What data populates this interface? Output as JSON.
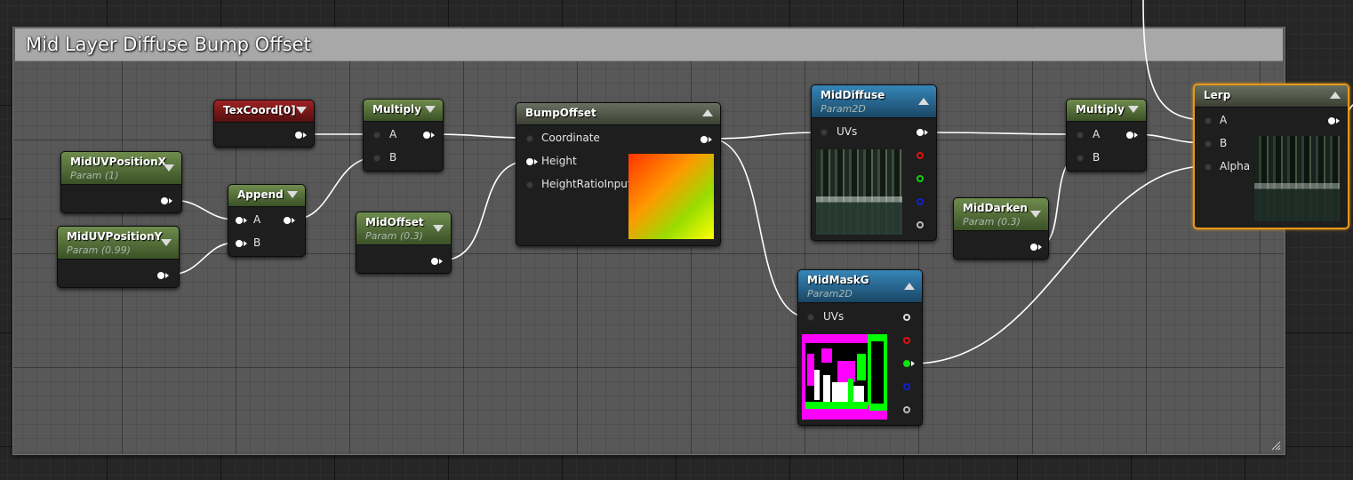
{
  "comment": {
    "title": "Mid Layer Diffuse Bump Offset"
  },
  "colors": {
    "param_header": "#5a7a3a",
    "texcoord_header": "#8b1a1a",
    "texture_header": "#2a6a9a",
    "selected_border": "#e79a17",
    "wire": "#ffffff"
  },
  "nodes": {
    "texcoord": {
      "title": "TexCoord[0]"
    },
    "mid_uv_x": {
      "title": "MidUVPositionX",
      "subtitle": "Param (1)"
    },
    "mid_uv_y": {
      "title": "MidUVPositionY",
      "subtitle": "Param (0.99)"
    },
    "append": {
      "title": "Append",
      "pin_a": "A",
      "pin_b": "B"
    },
    "multiply1": {
      "title": "Multiply",
      "pin_a": "A",
      "pin_b": "B"
    },
    "mid_offset": {
      "title": "MidOffset",
      "subtitle": "Param (0.3)"
    },
    "bump_offset": {
      "title": "BumpOffset",
      "pin_coordinate": "Coordinate",
      "pin_height": "Height",
      "pin_height_ratio": "HeightRatioInput"
    },
    "mid_diffuse": {
      "title": "MidDiffuse",
      "subtitle": "Param2D",
      "pin_uvs": "UVs"
    },
    "mid_mask_g": {
      "title": "MidMaskG",
      "subtitle": "Param2D",
      "pin_uvs": "UVs"
    },
    "mid_darken": {
      "title": "MidDarken",
      "subtitle": "Param (0.3)"
    },
    "multiply2": {
      "title": "Multiply",
      "pin_a": "A",
      "pin_b": "B"
    },
    "lerp": {
      "title": "Lerp",
      "pin_a": "A",
      "pin_b": "B",
      "pin_alpha": "Alpha"
    }
  }
}
